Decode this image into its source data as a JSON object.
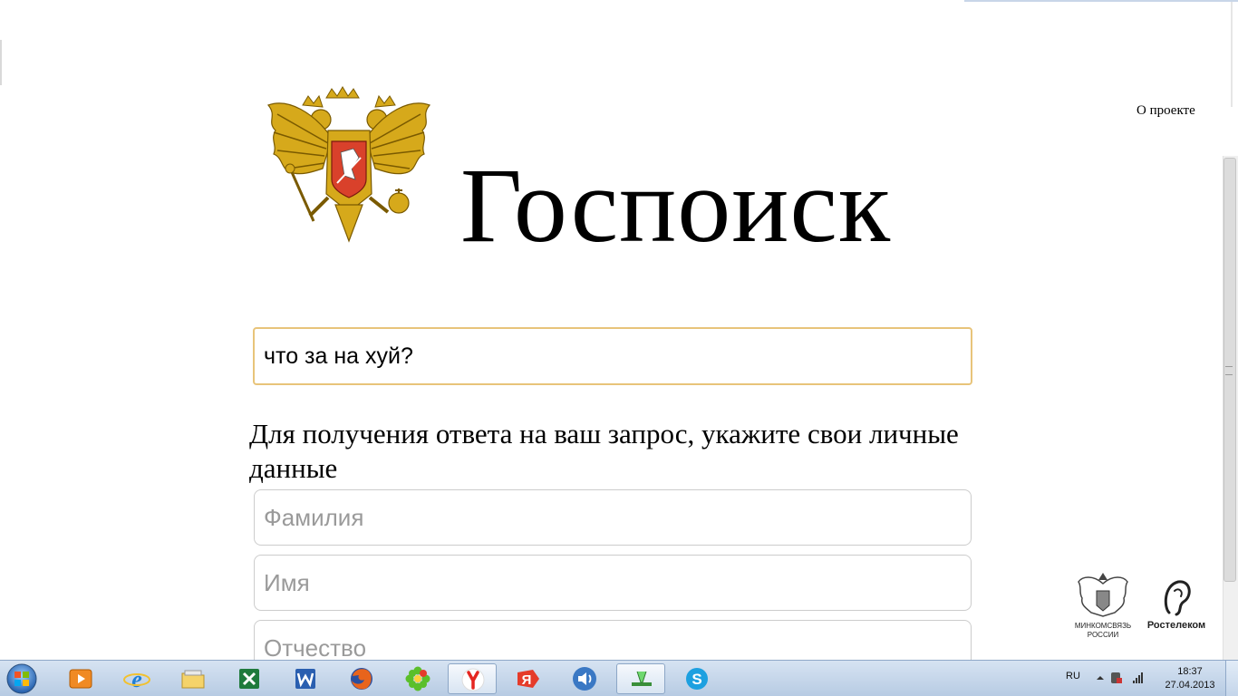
{
  "header": {
    "about_link": "О проекте",
    "site_title": "Госпоиск"
  },
  "search": {
    "value": "что за на хуй?"
  },
  "form": {
    "prompt": "Для получения ответа на ваш запрос, укажите свои личные данные",
    "fields": [
      {
        "placeholder": "Фамилия"
      },
      {
        "placeholder": "Имя"
      },
      {
        "placeholder": "Отчество"
      }
    ]
  },
  "partners": {
    "mks_label": "МИНКОМСВЯЗЬ РОССИИ",
    "rt_label": "Ростелеком"
  },
  "taskbar": {
    "apps": [
      "media-player-icon",
      "internet-explorer-icon",
      "file-explorer-icon",
      "excel-icon",
      "word-icon",
      "firefox-icon",
      "icq-icon",
      "yandex-browser-icon",
      "yandex-icon",
      "volume-icon",
      "network-gadget-icon",
      "skype-icon"
    ],
    "language": "RU",
    "time": "18:37",
    "date": "27.04.2013"
  },
  "colors": {
    "search_border": "#e8c47a",
    "taskbar": "#c6d7ea",
    "emblem_gold": "#d6a91b",
    "shield_red": "#d9412b"
  }
}
